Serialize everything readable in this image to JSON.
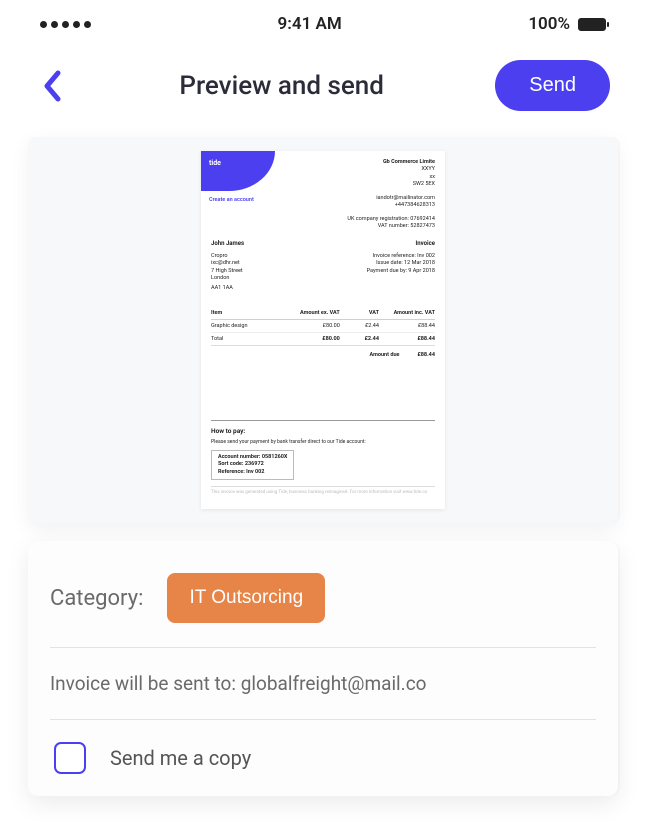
{
  "status_bar": {
    "time": "9:41 AM",
    "battery": "100%"
  },
  "header": {
    "title": "Preview and send",
    "send_label": "Send"
  },
  "invoice": {
    "brand": "tide",
    "create_account": "Create an account",
    "company": {
      "name": "Gb Commerce Limite",
      "line1": "XXYY",
      "line2": "xx",
      "postcode": "SW2 5EX",
      "email": "iandotr@mailinator.com",
      "phone": "+447384628313",
      "reg": "UK company registration: 07692414",
      "vat": "VAT number: 52827473"
    },
    "billto": {
      "name": "John James",
      "company": "Cropro",
      "email": "ixc@dhr.net",
      "addr": "7 High Street",
      "city": "London",
      "postcode": "AA1 1AA"
    },
    "meta": {
      "title": "Invoice",
      "ref": "Invoice reference: Inv 002",
      "issue": "Issue date: 12 Mar 2018",
      "due": "Payment due by: 9 Apr 2018"
    },
    "table": {
      "h1": "Item",
      "h2": "Amount ex. VAT",
      "h3": "VAT",
      "h4": "Amount inc. VAT",
      "item": "Graphic design",
      "ex": "£80.00",
      "vat": "£2.44",
      "inc": "£88.44",
      "total_label": "Total",
      "tex": "£80.00",
      "tvat": "£2.44",
      "tinc": "£88.44",
      "due_label": "Amount due",
      "due_val": "£88.44"
    },
    "howtopay": {
      "title": "How to pay:",
      "text": "Please send your payment by bank transfer direct to our Tide account:",
      "acc": "Account number: 0581260X",
      "sort": "Sort code: 236972",
      "ref": "Reference: Inv 002",
      "foot": "This invoice was generated using Tide, business banking reimagined. For more information visit www.tide.co"
    }
  },
  "form": {
    "category_label": "Category:",
    "category_value": "IT Outsorcing",
    "sendto_label": "Invoice will be sent to: ",
    "sendto_email": "globalfreight@mail.co",
    "copy_label": "Send me a copy"
  }
}
